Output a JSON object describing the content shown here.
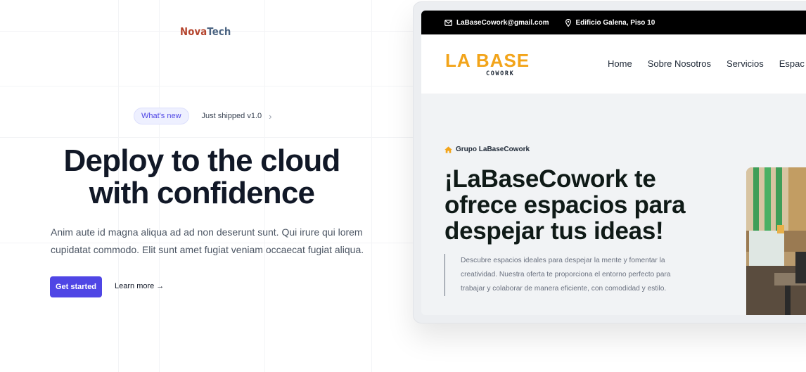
{
  "logo": {
    "part1": "Nova",
    "part2": "Tech"
  },
  "announcement": {
    "badge": "What's new",
    "text": "Just shipped v1.0",
    "chevron": "›"
  },
  "hero": {
    "title_line1": "Deploy to the cloud",
    "title_line2": "with confidence",
    "subtitle": "Anim aute id magna aliqua ad ad non deserunt sunt. Qui irure qui lorem cupidatat commodo. Elit sunt amet fugiat veniam occaecat fugiat aliqua.",
    "primary_button": "Get started",
    "secondary_link": "Learn more →"
  },
  "preview": {
    "topbar": {
      "email": "LaBaseCowork@gmail.com",
      "address": "Edificio Galena, Piso 10",
      "icons": [
        "envelope-icon",
        "map-pin-icon"
      ]
    },
    "brand": {
      "main": "LA BASE",
      "sub": "COWORK"
    },
    "nav": [
      "Home",
      "Sobre Nosotros",
      "Servicios",
      "Espac"
    ],
    "eyebrow": "Grupo LaBaseCowork",
    "eyebrow_icon": "home-icon",
    "heading_line1": "¡LaBaseCowork te",
    "heading_line2": "ofrece espacios para",
    "heading_line3": "despejar tus ideas!",
    "description": "Descubre espacios ideales para despejar la mente y fomentar la creatividad. Nuestra oferta te proporciona el entorno perfecto para trabajar y colaborar de manera eficiente, con comodidad y estilo."
  },
  "colors": {
    "accent": "#4f46e5",
    "brand_orange": "#f2a41a",
    "logo_red": "#b4432c",
    "logo_blue": "#4b6482"
  }
}
